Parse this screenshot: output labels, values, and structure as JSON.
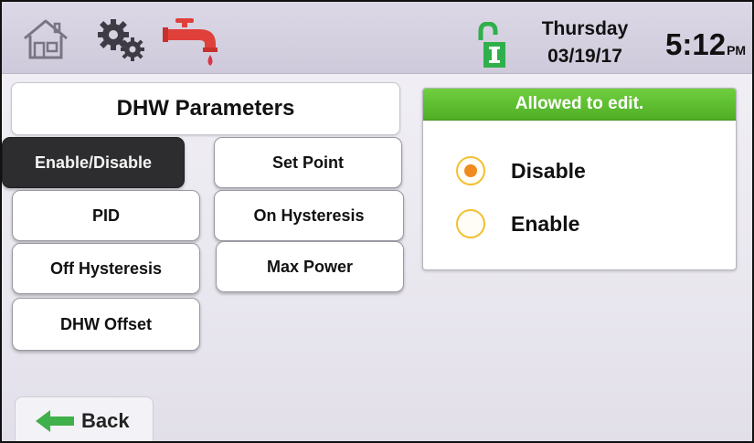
{
  "header": {
    "day": "Thursday",
    "date": "03/19/17",
    "time": "5:12",
    "ampm": "PM"
  },
  "title": "DHW Parameters",
  "params": [
    {
      "label": "Enable/Disable",
      "active": true
    },
    {
      "label": "Set Point",
      "active": false
    },
    {
      "label": "PID",
      "active": false
    },
    {
      "label": "On Hysteresis",
      "active": false
    },
    {
      "label": "Off Hysteresis",
      "active": false
    },
    {
      "label": "Max Power",
      "active": false
    },
    {
      "label": "DHW Offset",
      "active": false
    }
  ],
  "edit_panel": {
    "header": "Allowed to edit.",
    "options": [
      {
        "label": "Disable",
        "selected": true
      },
      {
        "label": "Enable",
        "selected": false
      }
    ]
  },
  "back_label": "Back",
  "colors": {
    "accent_green": "#4fae25",
    "lock_green": "#2fb04a",
    "tap_red": "#e0403a",
    "radio_border": "#f2c032",
    "radio_fill": "#f08a1c",
    "active_button": "#2d2c2e"
  },
  "icons": [
    "home-icon",
    "settings-gears-icon",
    "water-tap-icon",
    "unlocked-padlock-icon",
    "back-arrow-icon"
  ]
}
